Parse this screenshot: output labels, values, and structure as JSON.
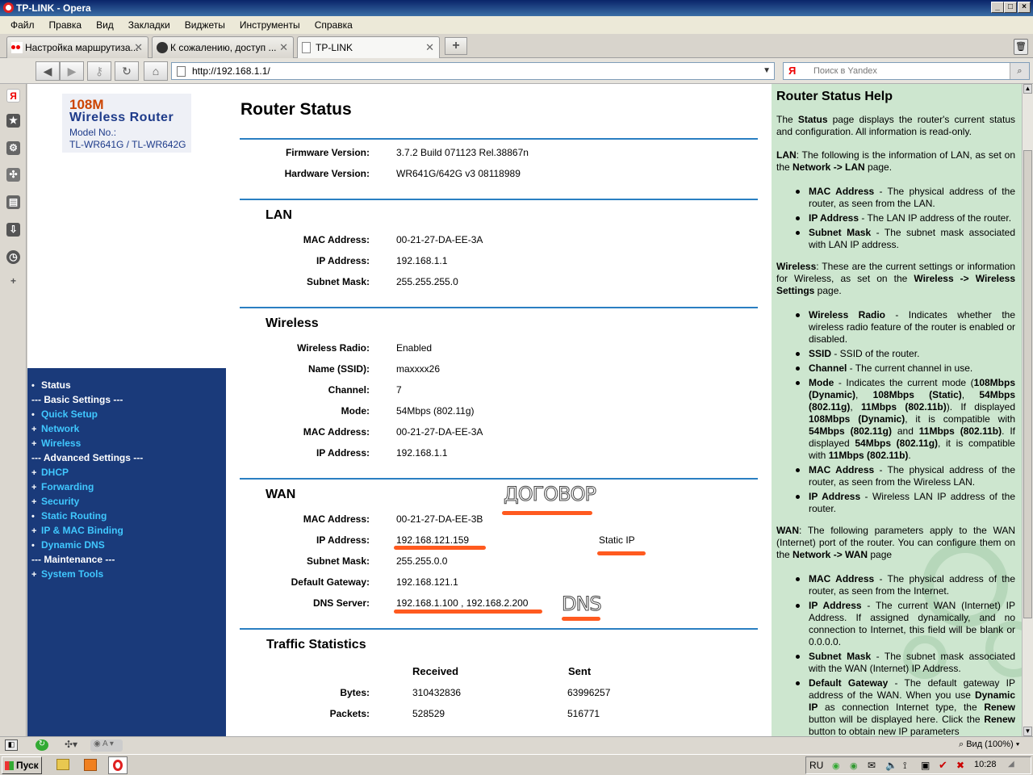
{
  "window": {
    "title": "TP-LINK - Opera"
  },
  "menu": [
    "Файл",
    "Правка",
    "Вид",
    "Закладки",
    "Виджеты",
    "Инструменты",
    "Справка"
  ],
  "tabs": [
    {
      "label": "Настройка маршрутиза..."
    },
    {
      "label": "К сожалению, доступ ..."
    },
    {
      "label": "TP-LINK"
    }
  ],
  "address": {
    "url": "http://192.168.1.1/"
  },
  "search": {
    "placeholder": "Поиск в Yandex",
    "engine_letter": "Я"
  },
  "logo": {
    "line1": "108M",
    "line2": "Wireless  Router",
    "line3": "Model No.:",
    "line4": "TL-WR641G / TL-WR642G"
  },
  "nav": [
    {
      "text": "Status",
      "kind": "current",
      "bullet": "•"
    },
    {
      "text": "--- Basic Settings ---",
      "kind": "head",
      "bullet": ""
    },
    {
      "text": "Quick Setup",
      "kind": "link",
      "bullet": "•"
    },
    {
      "text": "Network",
      "kind": "link",
      "bullet": "+"
    },
    {
      "text": "Wireless",
      "kind": "link",
      "bullet": "+"
    },
    {
      "text": "--- Advanced Settings ---",
      "kind": "head",
      "bullet": ""
    },
    {
      "text": "DHCP",
      "kind": "link",
      "bullet": "+"
    },
    {
      "text": "Forwarding",
      "kind": "link",
      "bullet": "+"
    },
    {
      "text": "Security",
      "kind": "link",
      "bullet": "+"
    },
    {
      "text": "Static Routing",
      "kind": "link",
      "bullet": "•"
    },
    {
      "text": "IP & MAC Binding",
      "kind": "link",
      "bullet": "+"
    },
    {
      "text": "Dynamic DNS",
      "kind": "link",
      "bullet": "•"
    },
    {
      "text": "--- Maintenance ---",
      "kind": "head",
      "bullet": ""
    },
    {
      "text": "System Tools",
      "kind": "link",
      "bullet": "+"
    }
  ],
  "status": {
    "title": "Router Status",
    "firmware_label": "Firmware Version:",
    "firmware": "3.7.2 Build 071123 Rel.38867n",
    "hardware_label": "Hardware Version:",
    "hardware": "WR641G/642G v3 08118989",
    "lan": {
      "title": "LAN",
      "mac_label": "MAC Address:",
      "mac": "00-21-27-DA-EE-3A",
      "ip_label": "IP Address:",
      "ip": "192.168.1.1",
      "mask_label": "Subnet Mask:",
      "mask": "255.255.255.0"
    },
    "wireless": {
      "title": "Wireless",
      "radio_label": "Wireless Radio:",
      "radio": "Enabled",
      "ssid_label": "Name (SSID):",
      "ssid": "maxxxx26",
      "channel_label": "Channel:",
      "channel": "7",
      "mode_label": "Mode:",
      "mode": "54Mbps (802.11g)",
      "mac_label": "MAC Address:",
      "mac": "00-21-27-DA-EE-3A",
      "ip_label": "IP Address:",
      "ip": "192.168.1.1"
    },
    "wan": {
      "title": "WAN",
      "mac_label": "MAC Address:",
      "mac": "00-21-27-DA-EE-3B",
      "ip_label": "IP Address:",
      "ip": "192.168.121.159",
      "conn_type": "Static IP",
      "mask_label": "Subnet Mask:",
      "mask": "255.255.0.0",
      "gw_label": "Default Gateway:",
      "gw": "192.168.121.1",
      "dns_label": "DNS Server:",
      "dns": "192.168.1.100 , 192.168.2.200"
    },
    "traffic": {
      "title": "Traffic Statistics",
      "col_received": "Received",
      "col_sent": "Sent",
      "bytes_label": "Bytes:",
      "bytes_received": "310432836",
      "bytes_sent": "63996257",
      "packets_label": "Packets:",
      "packets_received": "528529",
      "packets_sent": "516771"
    }
  },
  "annotations": {
    "contract": "ДОГОВОР",
    "dns": "DNS",
    "marker_color": "#ff5a1f"
  },
  "help": {
    "title": "Router Status Help",
    "intro_html": "The <b>Status</b> page displays the router's current status and configuration. All information is read-only.",
    "lan_html": "<b>LAN</b>: The following is the information of LAN, as set on the <b>Network -&gt; LAN</b> page.",
    "lan_items_html": [
      "<b>MAC Address</b> - The physical address of the router, as seen from the LAN.",
      "<b>IP Address</b> - The LAN IP address of the router.",
      "<b>Subnet Mask</b> - The subnet mask associated with LAN IP address."
    ],
    "wireless_html": "<b>Wireless</b>: These are the current settings or information for Wireless, as set on the <b>Wireless -&gt; Wireless Settings</b> page.",
    "wireless_items_html": [
      "<b>Wireless Radio</b> - Indicates whether the wireless radio feature of the router is enabled or disabled.",
      "<b>SSID</b> - SSID of the router.",
      "<b>Channel</b> - The current channel in use.",
      "<b>Mode</b> - Indicates the current mode (<b>108Mbps (Dynamic)</b>, <b>108Mbps (Static)</b>, <b>54Mbps (802.11g)</b>, <b>11Mbps (802.11b)</b>). If displayed <b>108Mbps (Dynamic)</b>, it is compatible with <b>54Mbps (802.11g)</b> and <b>11Mbps (802.11b)</b>. If displayed <b>54Mbps (802.11g)</b>, it is compatible with <b>11Mbps (802.11b)</b>.",
      "<b>MAC Address</b> - The physical address of the router, as seen from the Wireless LAN.",
      "<b>IP Address</b> - Wireless LAN IP address of the router."
    ],
    "wan_html": "<b>WAN</b>: The following parameters apply to the WAN (Internet) port of the router. You can configure them on the <b>Network -&gt; WAN</b> page",
    "wan_items_html": [
      "<b>MAC Address</b> - The physical address of the router, as seen from the Internet.",
      "<b>IP Address</b> - The current WAN (Internet) IP Address. If assigned dynamically, and no connection to Internet, this field will be blank or 0.0.0.0.",
      "<b>Subnet Mask</b> - The subnet mask associated with the WAN (Internet) IP Address.",
      "<b>Default Gateway</b> - The default gateway IP address of the WAN. When you use <b>Dynamic IP</b> as connection Internet type, the <b>Renew</b> button will be displayed here. Click the <b>Renew</b> button to obtain new IP parameters"
    ]
  },
  "statusbar": {
    "zoom": "Вид (100%)"
  },
  "taskbar": {
    "start": "Пуск",
    "lang": "RU",
    "clock": "10:28"
  }
}
